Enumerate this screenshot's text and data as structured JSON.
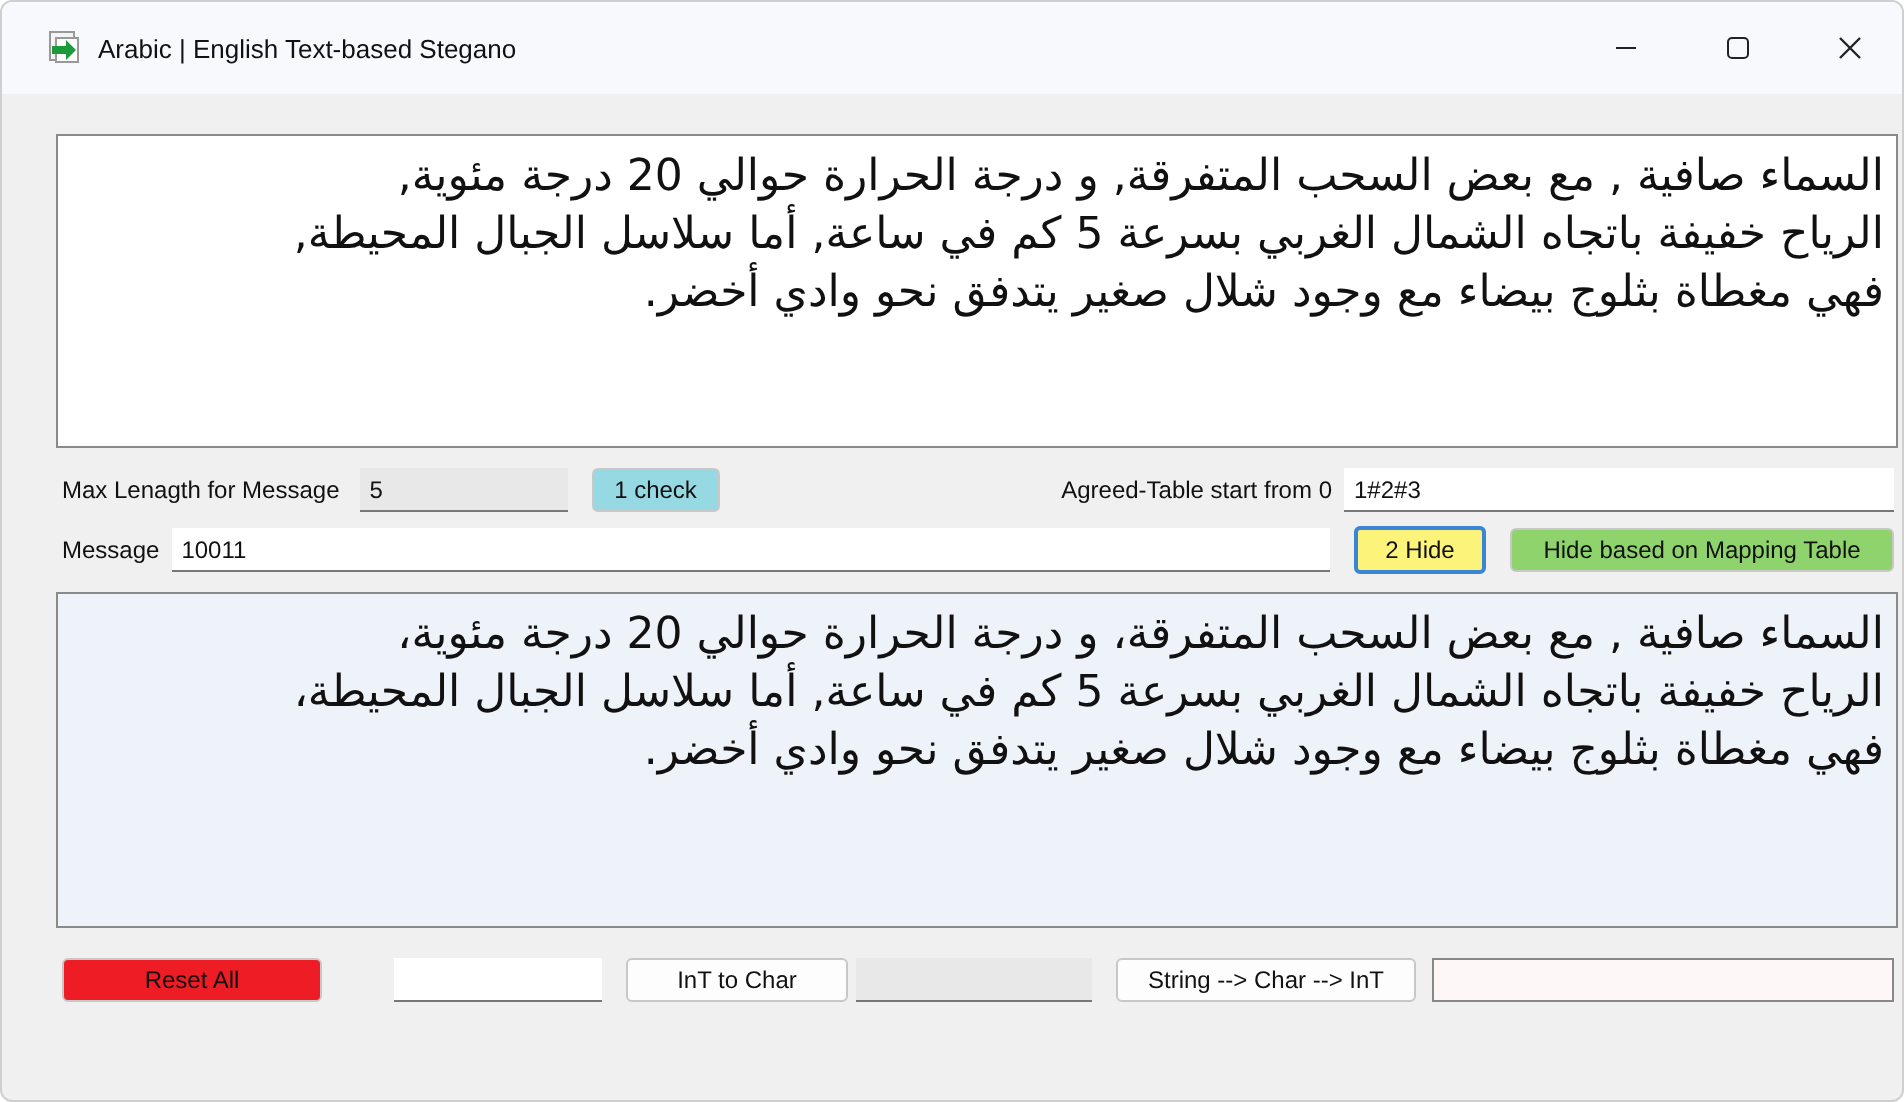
{
  "window": {
    "title": "Arabic | English Text-based Stegano"
  },
  "cover_text": {
    "lines": [
      "السماء صافية , مع بعض السحب المتفرقة, و درجة الحرارة حوالي 20 درجة مئوية,",
      "الرياح خفيفة باتجاه الشمال الغربي بسرعة 5 كم في ساعة, أما سلاسل الجبال المحيطة,",
      "فهي مغطاة بثلوج بيضاء مع وجود شلال صغير يتدفق نحو وادي أخضر."
    ]
  },
  "max_length": {
    "label": "Max Lenagth for Message",
    "value": "5",
    "check_button": "1 check"
  },
  "agreed_table": {
    "label": "Agreed-Table start from 0",
    "value": "1#2#3"
  },
  "message": {
    "label": "Message",
    "value": "10011",
    "hide_button": "2 Hide",
    "mapping_button": "Hide based on Mapping Table"
  },
  "stego_text": {
    "lines": [
      "السماء صافية , مع بعض السحب المتفرقة، و درجة الحرارة حوالي 20 درجة مئوية،",
      "الرياح خفيفة باتجاه الشمال الغربي بسرعة 5 كم في ساعة, أما سلاسل الجبال المحيطة،",
      "فهي مغطاة بثلوج بيضاء مع وجود شلال صغير يتدفق نحو وادي أخضر."
    ]
  },
  "bottom": {
    "reset_button": "Reset All",
    "int_to_char_button": "InT to Char",
    "string_button": "String --> Char --> InT"
  }
}
